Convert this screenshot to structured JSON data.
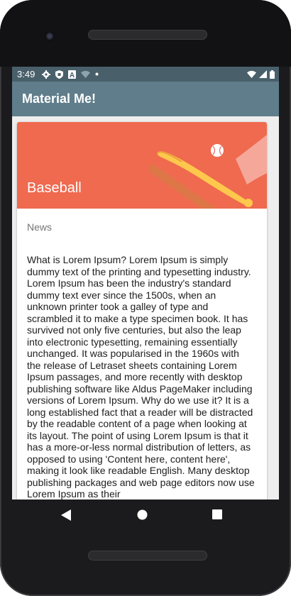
{
  "status_bar": {
    "time": "3:49",
    "left_icons": [
      "settings-icon",
      "shield-icon",
      "font-a-icon",
      "wifi-off-icon",
      "dot-icon"
    ],
    "right_icons": [
      "wifi-icon",
      "signal-icon",
      "battery-icon"
    ]
  },
  "app_bar": {
    "title": "Material Me!"
  },
  "card": {
    "title": "Baseball",
    "subtitle": "News",
    "image_icon": "baseball-bat-icon",
    "body": "What is Lorem Ipsum? Lorem Ipsum is simply dummy text of the printing and typesetting industry. Lorem Ipsum has been the industry's standard dummy text ever since the 1500s, when an unknown printer took a galley of type and scrambled it to make a type specimen book. It has survived not only five centuries, but also the leap into electronic typesetting, remaining essentially unchanged. It was popularised in the 1960s with the release of Letraset sheets containing Lorem Ipsum passages, and more recently with desktop publishing software like Aldus PageMaker including versions of Lorem Ipsum. Why do we use it? It is a long established fact that a reader will be distracted by the readable content of a page when looking at its layout. The point of using Lorem Ipsum is that it has a more-or-less normal distribution of letters, as opposed to using 'Content here, content here', making it look like readable English. Many desktop publishing packages and web page editors now use Lorem Ipsum as their"
  },
  "nav_bar": {
    "buttons": [
      "back-icon",
      "home-icon",
      "recent-apps-icon"
    ]
  },
  "colors": {
    "status_bar": "#49606b",
    "app_bar": "#607d8b",
    "card_image": "#ef6a4f",
    "background": "#eeeeee"
  }
}
